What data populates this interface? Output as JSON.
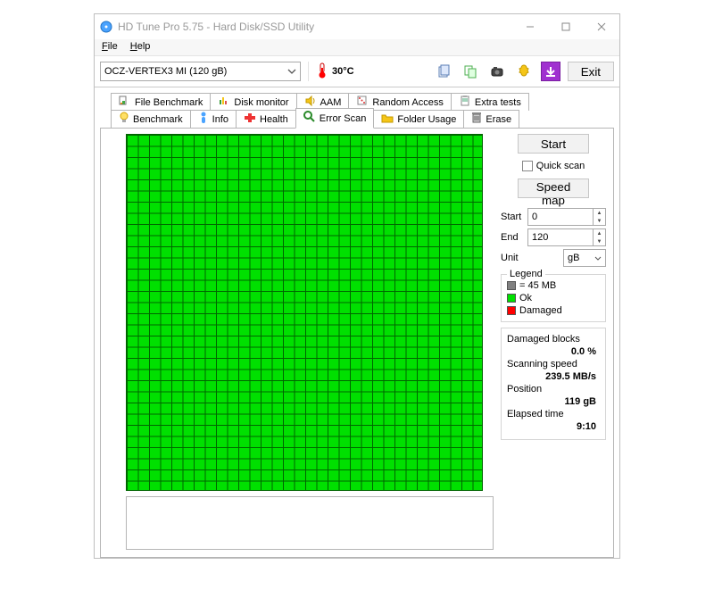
{
  "window": {
    "title": "HD Tune Pro 5.75 - Hard Disk/SSD Utility"
  },
  "menu": {
    "file": "File",
    "help": "Help"
  },
  "toolbar": {
    "drive": "OCZ-VERTEX3 MI (120 gB)",
    "temperature": "30°C",
    "exit": "Exit"
  },
  "tabs": {
    "row1": {
      "file_benchmark": "File Benchmark",
      "disk_monitor": "Disk monitor",
      "aam": "AAM",
      "random_access": "Random Access",
      "extra_tests": "Extra tests"
    },
    "row2": {
      "benchmark": "Benchmark",
      "info": "Info",
      "health": "Health",
      "error_scan": "Error Scan",
      "folder_usage": "Folder Usage",
      "erase": "Erase"
    }
  },
  "panel": {
    "start_btn": "Start",
    "quick_scan": "Quick scan",
    "speed_map_btn": "Speed map",
    "start_label": "Start",
    "start_value": "0",
    "end_label": "End",
    "end_value": "120",
    "unit_label": "Unit",
    "unit_value": "gB"
  },
  "legend": {
    "title": "Legend",
    "block_size": "= 45 MB",
    "ok": "Ok",
    "damaged": "Damaged",
    "colors": {
      "ok": "#00e000",
      "damaged": "#ff0000",
      "neutral": "#808080"
    }
  },
  "stats": {
    "damaged_label": "Damaged blocks",
    "damaged_value": "0.0 %",
    "speed_label": "Scanning speed",
    "speed_value": "239.5 MB/s",
    "position_label": "Position",
    "position_value": "119 gB",
    "elapsed_label": "Elapsed time",
    "elapsed_value": "9:10"
  }
}
